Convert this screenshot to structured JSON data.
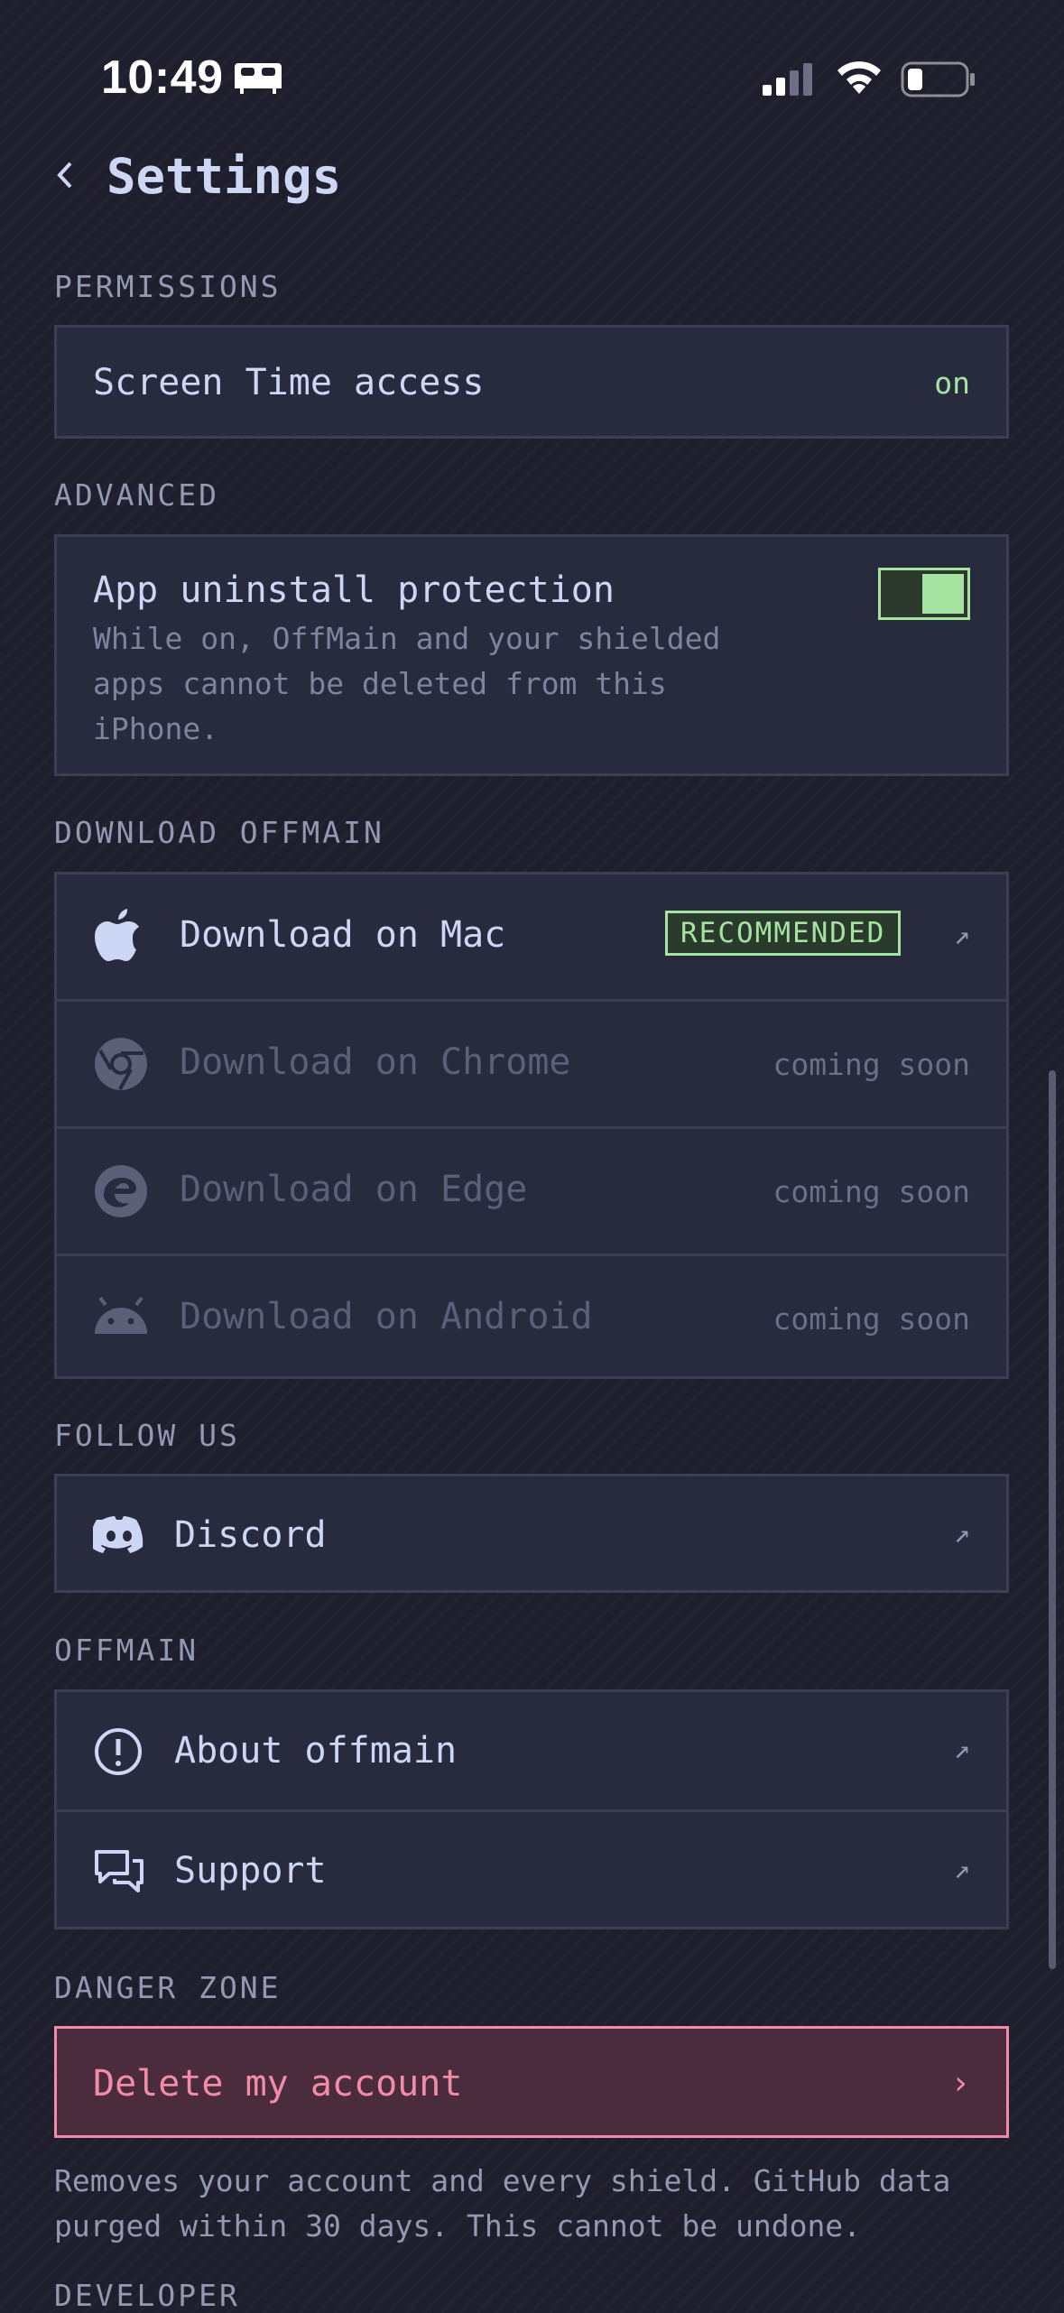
{
  "status_bar": {
    "time": "10:49",
    "bed_icon": "bed-icon",
    "signal_icon": "cellular-signal-icon",
    "wifi_icon": "wifi-icon",
    "battery_icon": "battery-icon"
  },
  "header": {
    "back_icon": "chevron-left-icon",
    "title": "Settings"
  },
  "permissions": {
    "label": "PERMISSIONS",
    "screen_time": {
      "label": "Screen Time access",
      "value": "on"
    }
  },
  "advanced": {
    "label": "ADVANCED",
    "uninstall_protection": {
      "title": "App uninstall protection",
      "description": "While on, OffMain and your shielded apps cannot be deleted from this iPhone.",
      "enabled": true
    }
  },
  "download": {
    "label": "DOWNLOAD OFFMAIN",
    "items": [
      {
        "icon": "apple-icon",
        "label": "Download on Mac",
        "badge": "RECOMMENDED",
        "trailing": "↗"
      },
      {
        "icon": "chrome-icon",
        "label": "Download on Chrome",
        "status": "coming soon"
      },
      {
        "icon": "edge-icon",
        "label": "Download on Edge",
        "status": "coming soon"
      },
      {
        "icon": "android-icon",
        "label": "Download on Android",
        "status": "coming soon"
      }
    ]
  },
  "follow": {
    "label": "FOLLOW US",
    "discord": {
      "icon": "discord-icon",
      "label": "Discord",
      "trailing": "↗"
    }
  },
  "offmain": {
    "label": "OFFMAIN",
    "items": [
      {
        "icon": "info-circle-icon",
        "label": "About offmain",
        "trailing": "↗"
      },
      {
        "icon": "chat-bubbles-icon",
        "label": "Support",
        "trailing": "↗"
      }
    ]
  },
  "danger": {
    "label": "DANGER ZONE",
    "delete": {
      "label": "Delete my account",
      "trailing": "›"
    },
    "note": "Removes your account and every shield. GitHub data purged within 30 days. This cannot be undone."
  },
  "developer": {
    "label": "DEVELOPER"
  },
  "colors": {
    "accent_green": "#a6e3a1",
    "danger_pink": "#f38ba8",
    "background": "#1e1e2c",
    "card": "#282a3e"
  }
}
